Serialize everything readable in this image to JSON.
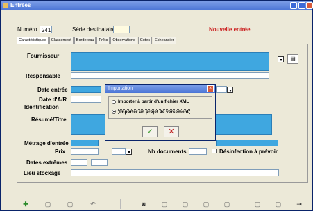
{
  "window": {
    "title": "Entrées"
  },
  "header": {
    "numero_label": "Numéro",
    "numero_value": "241",
    "serie_label": "Série destinataire",
    "serie_value": "",
    "status_text": "Nouvelle entrée"
  },
  "tabs": [
    "Caractéristiques",
    "Classement",
    "Bordereau",
    "Prêts",
    "Observations",
    "Cotes",
    "Echeancier"
  ],
  "form": {
    "fournisseur_label": "Fournisseur",
    "responsable_label": "Responsable",
    "date_entree_label": "Date entrée",
    "date_ar_label": "Date d'A/R",
    "identification_label": "Identification",
    "resume_label": "Résumé/Titre",
    "metrage_label": "Métrage d'entrée",
    "prix_label": "Prix",
    "nb_documents_label": "Nb documents",
    "desinfection_label": "Désinfection à prévoir",
    "dates_extremes_label": "Dates extrêmes",
    "lieu_stockage_label": "Lieu stockage"
  },
  "dialog": {
    "title": "Importation",
    "option1": "Importer à partir d'un fichier XML",
    "option2": "Importer un projet de versement",
    "ok_symbol": "✓",
    "cancel_symbol": "✕"
  },
  "colors": {
    "field_blue": "#3fa7e0",
    "status_red": "#cc2222",
    "titlebar": "#4a74d6"
  }
}
